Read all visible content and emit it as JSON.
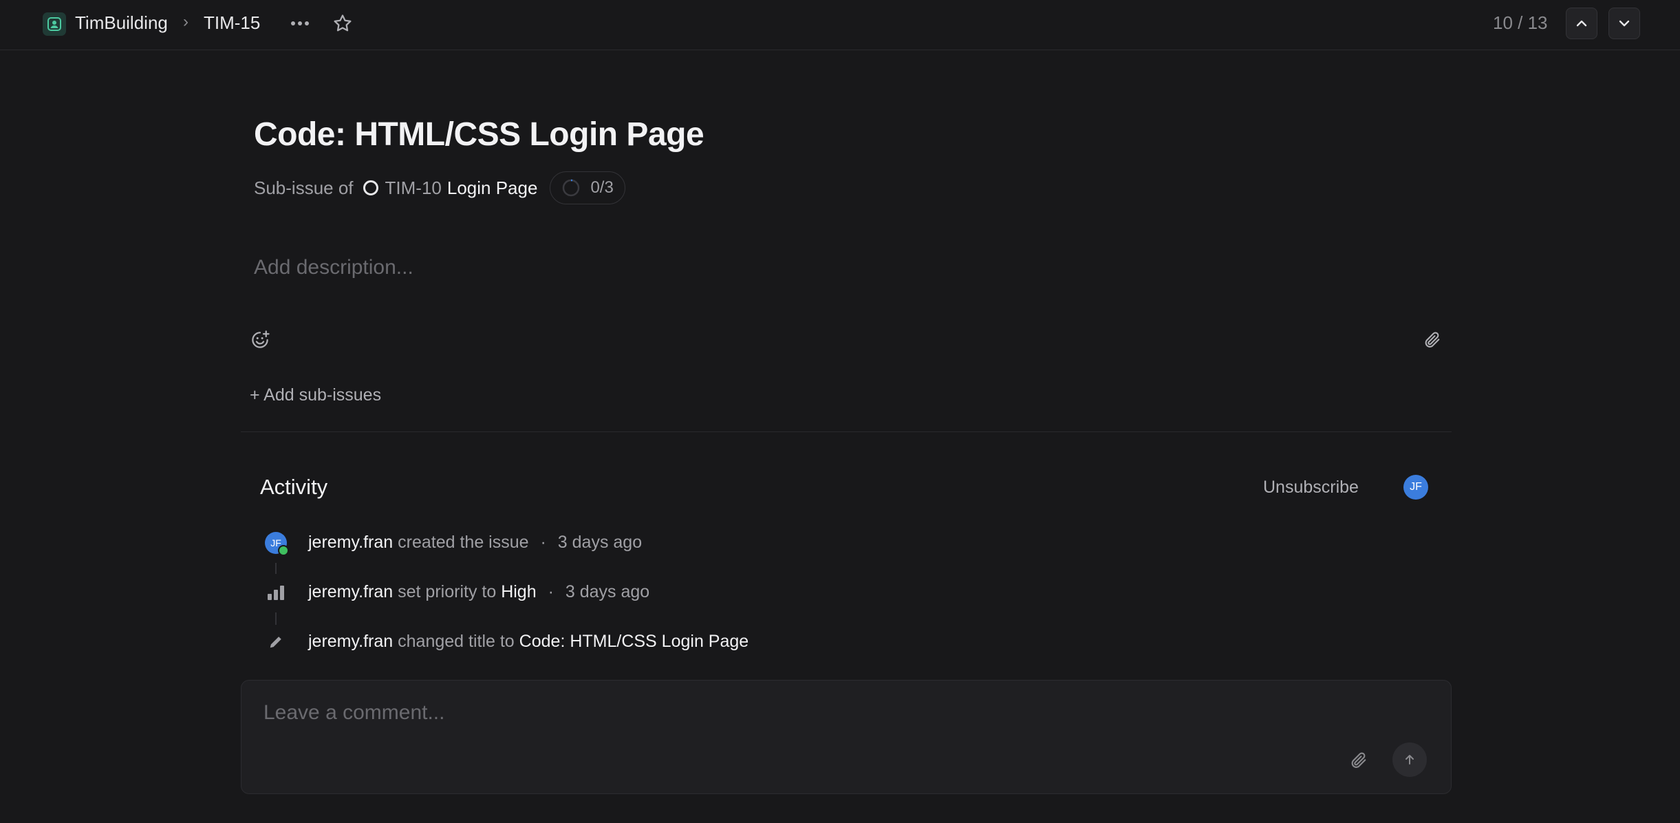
{
  "header": {
    "team_name": "TimBuilding",
    "breadcrumb_separator": "›",
    "issue_id": "TIM-15",
    "pager": "10 / 13",
    "icons": [
      "team-icon",
      "more-icon",
      "star-icon",
      "chevron-up-icon",
      "chevron-down-icon"
    ]
  },
  "issue": {
    "title": "Code: HTML/CSS Login Page",
    "subissue_label": "Sub-issue of",
    "parent_id": "TIM-10",
    "parent_title": "Login Page",
    "parent_progress": "0/3",
    "description_placeholder": "Add description...",
    "add_subissues_label": "+ Add sub-issues"
  },
  "activity": {
    "title": "Activity",
    "unsubscribe_label": "Unsubscribe",
    "subscriber_initials": "JF",
    "events": [
      {
        "user": "jeremy.fran",
        "initials": "JF",
        "action": "created the issue",
        "value": "",
        "time": "3 days ago",
        "icon": "avatar"
      },
      {
        "user": "jeremy.fran",
        "action": "set priority to",
        "value": "High",
        "time": "3 days ago",
        "icon": "priority-high-icon"
      },
      {
        "user": "jeremy.fran",
        "action": "changed title to",
        "value": "Code: HTML/CSS Login Page",
        "time": "",
        "icon": "pencil-icon"
      }
    ]
  },
  "comment": {
    "placeholder": "Leave a comment..."
  },
  "colors": {
    "background": "#18181a",
    "avatar": "#3b7ddd",
    "online": "#3fbf5f",
    "team_icon": "#4cc9a0"
  }
}
